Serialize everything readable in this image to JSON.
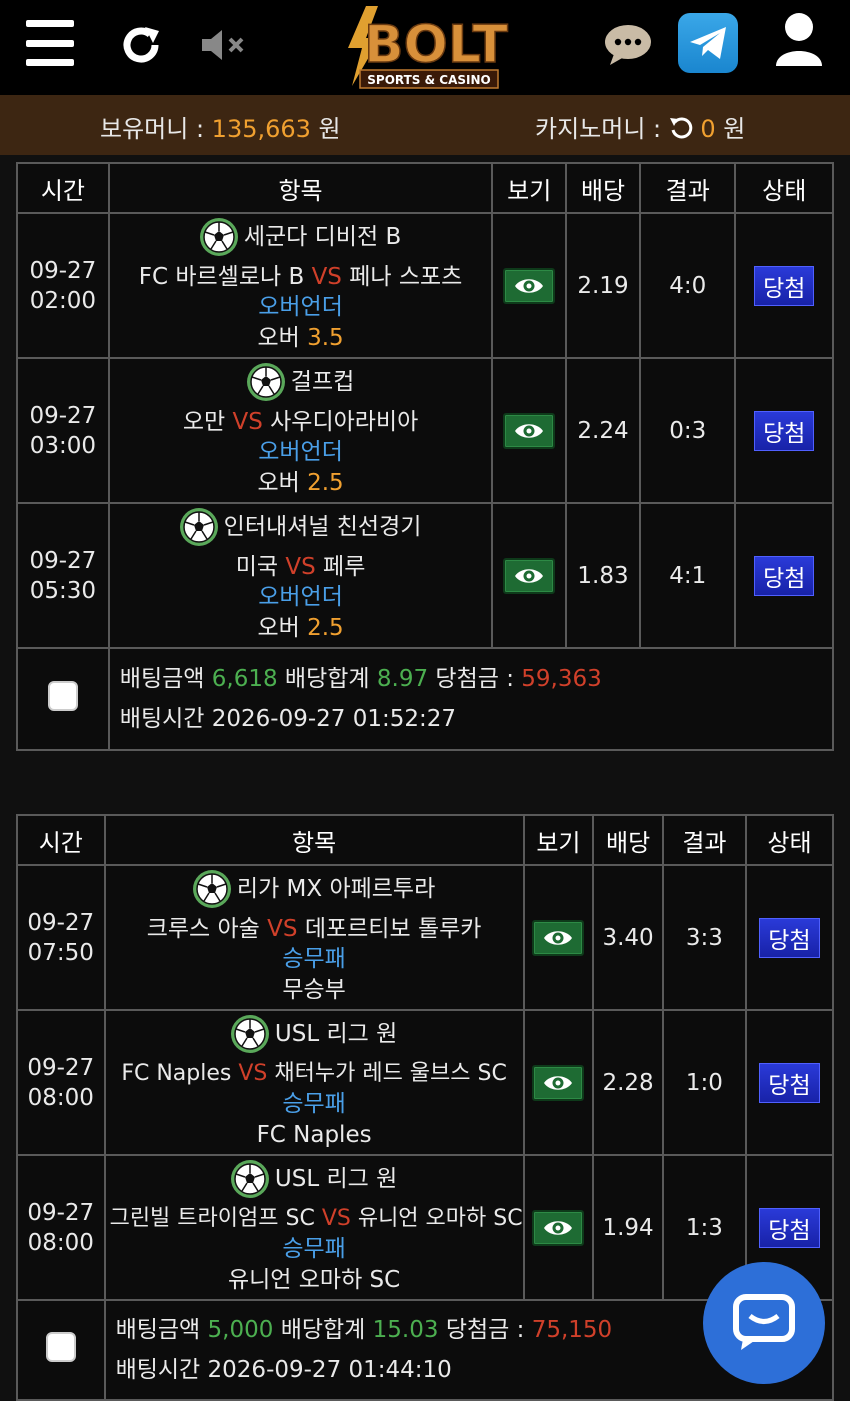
{
  "header": {
    "logo_text": "BOLT",
    "logo_sub": "SPORTS & CASINO",
    "icons": [
      "menu-icon",
      "refresh-icon",
      "mute-icon",
      "chat-icon",
      "telegram-icon",
      "user-icon"
    ]
  },
  "money": {
    "holding_label": "보유머니 : ",
    "holding_value": "135,663",
    "holding_unit": " 원",
    "casino_label": "카지노머니 : ",
    "casino_value": "0",
    "casino_unit": " 원"
  },
  "columns": [
    "시간",
    "항목",
    "보기",
    "배당",
    "결과",
    "상태"
  ],
  "slips": [
    {
      "bets": [
        {
          "date": "09-27",
          "time": "02:00",
          "league": "세군다 디비전 B",
          "home": "FC 바르셀로나 B",
          "vs": "VS",
          "away": "페나 스포츠",
          "bet_type": "오버언더",
          "pick_label": "오버 ",
          "pick_value": "3.5",
          "odds": "2.19",
          "result": "4:0",
          "status": "당첨"
        },
        {
          "date": "09-27",
          "time": "03:00",
          "league": "걸프컵",
          "home": "오만",
          "vs": "VS",
          "away": "사우디아라비아",
          "bet_type": "오버언더",
          "pick_label": "오버 ",
          "pick_value": "2.5",
          "odds": "2.24",
          "result": "0:3",
          "status": "당첨"
        },
        {
          "date": "09-27",
          "time": "05:30",
          "league": "인터내셔널 친선경기",
          "home": "미국",
          "vs": "VS",
          "away": "페루",
          "bet_type": "오버언더",
          "pick_label": "오버 ",
          "pick_value": "2.5",
          "odds": "1.83",
          "result": "4:1",
          "status": "당첨"
        }
      ],
      "summary": {
        "amount_label": "배팅금액 ",
        "amount": "6,618",
        "odds_label": " 배당합계 ",
        "odds_total": "8.97",
        "win_label": " 당첨금 : ",
        "win": "59,363",
        "time_label": "배팅시간 ",
        "time": "2026-09-27 01:52:27"
      }
    },
    {
      "bets": [
        {
          "date": "09-27",
          "time": "07:50",
          "league": "리가 MX 아페르투라",
          "home": "크루스 아술",
          "vs": "VS",
          "away": "데포르티보 톨루카",
          "bet_type": "승무패",
          "pick_label": "무승부",
          "pick_value": "",
          "odds": "3.40",
          "result": "3:3",
          "status": "당첨"
        },
        {
          "date": "09-27",
          "time": "08:00",
          "league": "USL 리그 원",
          "home": "FC Naples",
          "vs": "VS",
          "away": "채터누가 레드 울브스 SC",
          "bet_type": "승무패",
          "pick_label": "FC Naples",
          "pick_value": "",
          "odds": "2.28",
          "result": "1:0",
          "status": "당첨"
        },
        {
          "date": "09-27",
          "time": "08:00",
          "league": "USL 리그 원",
          "home": "그린빌 트라이엄프 SC",
          "vs": "VS",
          "away": "유니언 오마하 SC",
          "bet_type": "승무패",
          "pick_label": "유니언 오마하 SC",
          "pick_value": "",
          "odds": "1.94",
          "result": "1:3",
          "status": "당첨"
        }
      ],
      "summary": {
        "amount_label": "배팅금액 ",
        "amount": "5,000",
        "odds_label": " 배당합계 ",
        "odds_total": "15.03",
        "win_label": " 당첨금 : ",
        "win": "75,150",
        "time_label": "배팅시간 ",
        "time": "2026-09-27 01:44:10"
      }
    }
  ]
}
